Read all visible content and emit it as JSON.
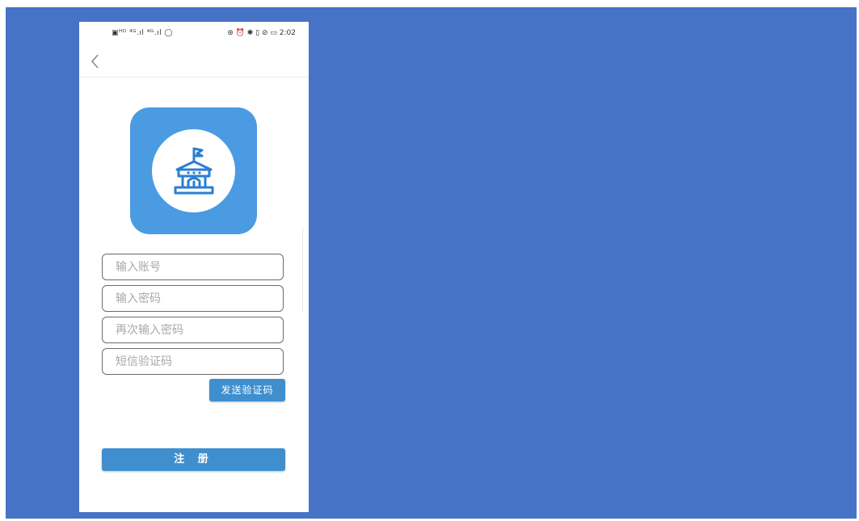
{
  "status_bar": {
    "left_icons": "▣ᴴᴰ ⁴ᴳ.ıl ⁴ᴳ.ıl ◯",
    "right_icons": "⊛ ⏰ ✱ ▯ ⊘ ▭",
    "time": "2:02"
  },
  "nav": {
    "back_icon": "chevron-left"
  },
  "logo": {
    "icon": "government-building-icon",
    "tile_color": "#4a9be2",
    "glyph_color": "#2a7fd0"
  },
  "form": {
    "account_placeholder": "输入账号",
    "password_placeholder": "输入密码",
    "confirm_password_placeholder": "再次输入密码",
    "sms_code_placeholder": "短信验证码",
    "send_code_label": "发送验证码",
    "register_label": "注 册"
  },
  "colors": {
    "background": "#4673c6",
    "button": "#3f8fcf"
  }
}
